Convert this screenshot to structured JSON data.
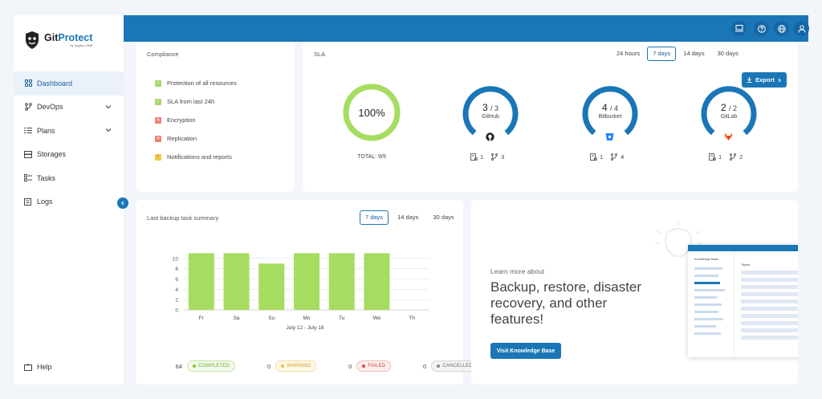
{
  "brand": {
    "name_part1": "Git",
    "name_part2": "Protect",
    "tagline": "by Xopero ONE"
  },
  "sidebar": {
    "items": [
      {
        "label": "Dashboard",
        "icon": "grid-icon",
        "active": true
      },
      {
        "label": "DevOps",
        "icon": "branch-icon",
        "expandable": true
      },
      {
        "label": "Plans",
        "icon": "list-icon",
        "expandable": true
      },
      {
        "label": "Storages",
        "icon": "storage-icon"
      },
      {
        "label": "Tasks",
        "icon": "tasks-icon"
      },
      {
        "label": "Logs",
        "icon": "logs-icon"
      }
    ],
    "help_label": "Help"
  },
  "topbar": {
    "icons": [
      "device-icon",
      "help-icon",
      "globe-icon",
      "user-icon"
    ]
  },
  "compliance": {
    "title": "Compliance",
    "items": [
      {
        "label": "Protection of all resources",
        "status": "ok"
      },
      {
        "label": "SLA from last 24h",
        "status": "ok"
      },
      {
        "label": "Encryption",
        "status": "failed"
      },
      {
        "label": "Replication",
        "status": "failed"
      },
      {
        "label": "Notifications and reports",
        "status": "warning"
      }
    ]
  },
  "sla": {
    "title": "SLA",
    "ranges": [
      "24 hours",
      "7 days",
      "14 days",
      "30 days"
    ],
    "selected_range": "7 days",
    "export_label": "Export",
    "total_label": "TOTAL: 9/9",
    "overall_value": "100%",
    "overall_percent": 100,
    "platforms": [
      {
        "done": "3",
        "total": "/ 3",
        "name": "GitHub",
        "icon": "github-icon",
        "servers": "1",
        "repos": "3"
      },
      {
        "done": "4",
        "total": "/ 4",
        "name": "Bitbucket",
        "icon": "bitbucket-icon",
        "servers": "1",
        "repos": "4"
      },
      {
        "done": "2",
        "total": "/ 2",
        "name": "GitLab",
        "icon": "gitlab-icon",
        "servers": "1",
        "repos": "2"
      }
    ],
    "colors": {
      "overall": "#a6dc60",
      "platform": "#1a76b6"
    }
  },
  "backup": {
    "title": "Last backup task summary",
    "ranges": [
      "7 days",
      "14 days",
      "30 days"
    ],
    "selected_range": "7 days",
    "legend": [
      {
        "count": "64",
        "label": "COMPLETED",
        "color": "#7dc63b"
      },
      {
        "count": "0",
        "label": "WARNING",
        "color": "#f5b82e"
      },
      {
        "count": "0",
        "label": "FAILED",
        "color": "#e04a3c"
      },
      {
        "count": "0",
        "label": "CANCELLED",
        "color": "#888888"
      }
    ]
  },
  "chart_data": {
    "type": "bar",
    "categories": [
      "Fr",
      "Sa",
      "Su",
      "Mo",
      "Tu",
      "We",
      "Th"
    ],
    "values": [
      11,
      11,
      9,
      11,
      11,
      11,
      0
    ],
    "yticks": [
      0,
      2,
      4,
      6,
      8,
      10
    ],
    "ylim": [
      0,
      12
    ],
    "xlabel": "July 12 - July 18",
    "ylabel": "",
    "grid": true,
    "bar_color": "#a6dc60"
  },
  "knowledge": {
    "subtitle": "Learn more about",
    "heading": "Backup, restore, disaster recovery, and other features!",
    "button_label": "Visit Knowledge Base",
    "mock_left_title": "Knowledge Base",
    "mock_right_title": "Topics"
  }
}
